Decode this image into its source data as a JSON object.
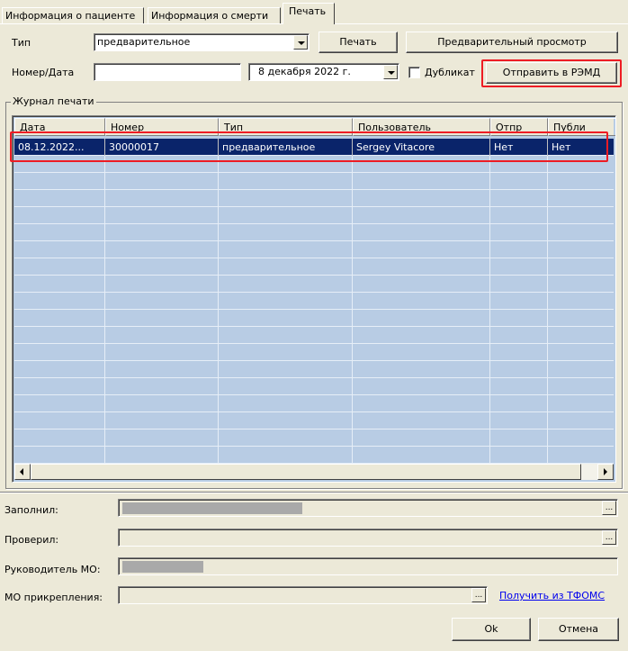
{
  "tabs": [
    {
      "label": "Информация о пациенте",
      "active": false
    },
    {
      "label": "Информация о смерти",
      "active": false
    },
    {
      "label": "Печать",
      "active": true
    }
  ],
  "form": {
    "type_label": "Тип",
    "type_value": "предварительное",
    "print_button": "Печать",
    "preview_button": "Предварительный просмотр",
    "number_date_label": "Номер/Дата",
    "number_value": "",
    "date_value": "8 декабря  2022 г.",
    "duplicate_label": "Дубликат",
    "duplicate_checked": false,
    "send_remd_button": "Отправить в РЭМД"
  },
  "journal": {
    "title": "Журнал печати",
    "columns": [
      "Дата",
      "Номер",
      "Тип",
      "Пользователь",
      "Отпр",
      "Публи"
    ],
    "rows": [
      {
        "selected": true,
        "cells": [
          "08.12.2022...",
          "30000017",
          "предварительное",
          "Sergey Vitacore",
          "Нет",
          "Нет"
        ]
      }
    ],
    "empty_rows": 18
  },
  "footer": {
    "filled_label": "Заполнил:",
    "checked_label": "Проверил:",
    "head_label": "Руководитель МО:",
    "attach_label": "МО прикрепления:",
    "tfoms_link": "Получить из ТФОМС",
    "ok_button": "Ok",
    "cancel_button": "Отмена",
    "ellipsis": "..."
  },
  "colors": {
    "window_bg": "#ece9d8",
    "grid_bg": "#b8cce4",
    "selection": "#0a246a",
    "highlight_red": "#ee1c24",
    "link": "#0000ee"
  }
}
